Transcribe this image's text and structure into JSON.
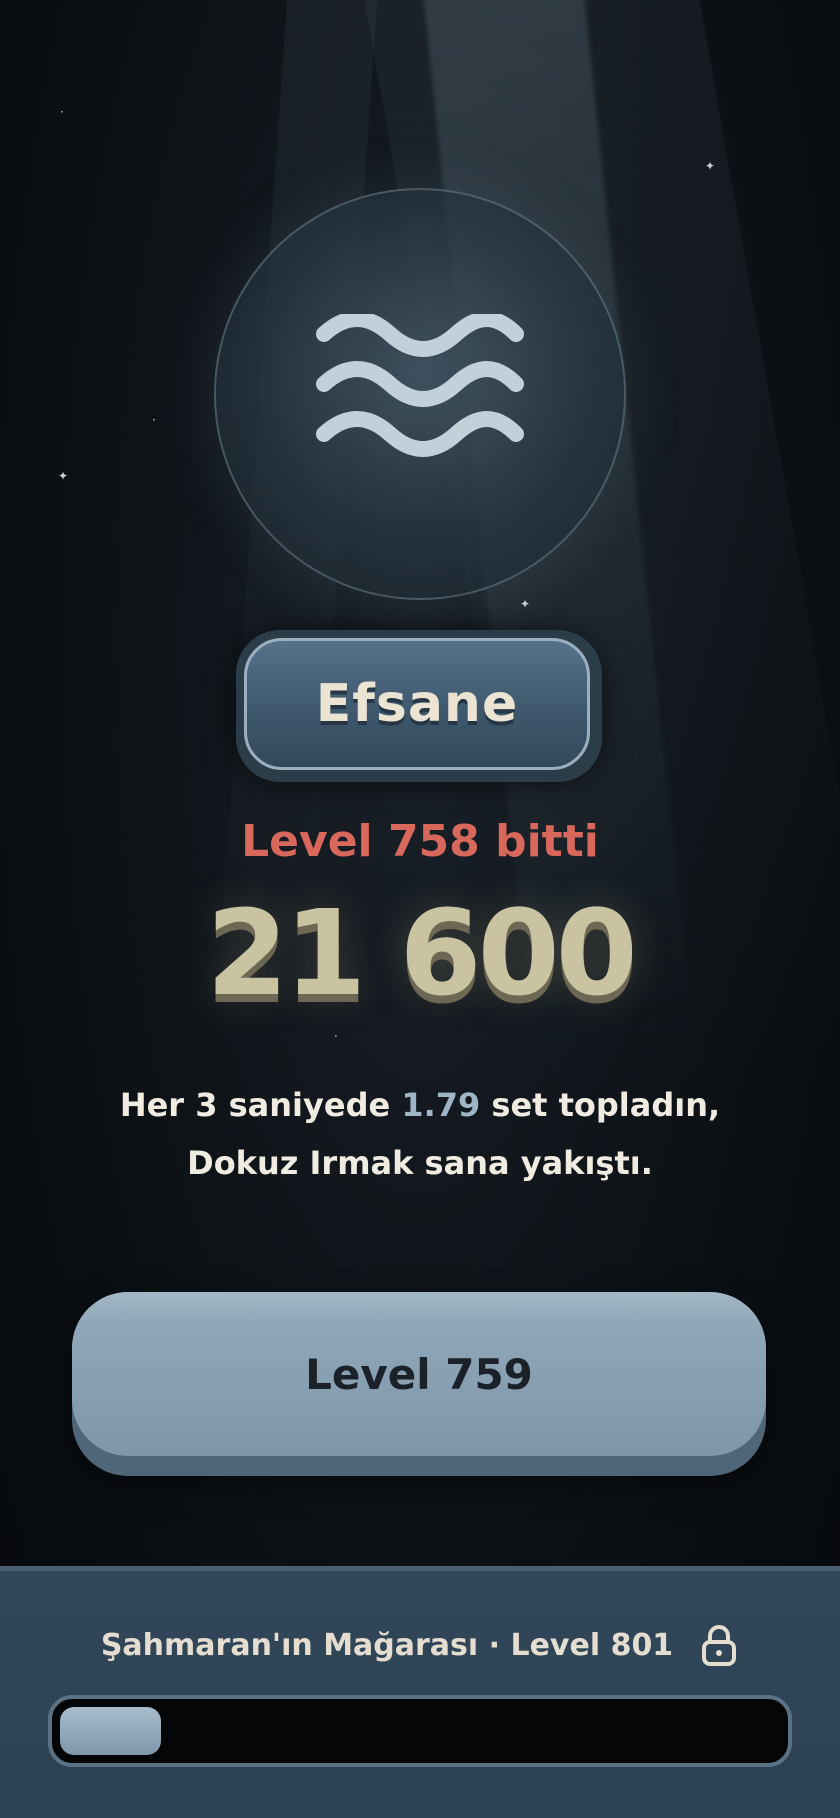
{
  "result": {
    "rank_label": "Efsane",
    "level_done_text": "Level 758 bitti",
    "score": "21 600",
    "message": {
      "line1_prefix": "Her 3 saniyede ",
      "line1_value": "1.79",
      "line1_suffix": " set topladın,",
      "line2": "Dokuz Irmak sana yakıştı."
    },
    "emblem_icon": "water-waves-icon"
  },
  "next_button": {
    "label": "Level 759"
  },
  "footer": {
    "next_area_label": "Şahmaran'ın Mağarası · Level 801",
    "lock_icon": "lock-icon",
    "progress_fraction": 0.14
  },
  "colors": {
    "accent_red": "#d8675c",
    "score_gold": "#c9c3a2",
    "highlight_blue": "#9fb6c6",
    "button_blue": "#8fa7b8"
  }
}
